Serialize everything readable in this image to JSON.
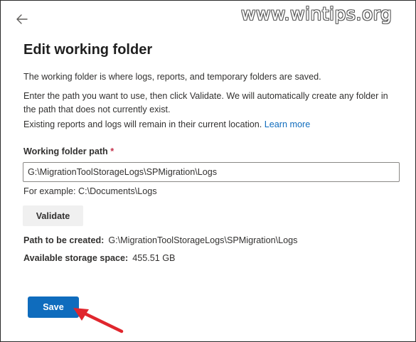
{
  "watermark": "www.wintips.org",
  "header": {
    "back_icon": "arrow-left-icon"
  },
  "page": {
    "title": "Edit working folder",
    "description_1": "The working folder is where logs, reports, and temporary folders are saved.",
    "description_2": "Enter the path you want to use, then click Validate. We will automatically create any folder in the path that does not currently exist.",
    "description_3": "Existing reports and logs will remain in their current location.",
    "learn_more": "Learn more"
  },
  "form": {
    "path_label": "Working folder path",
    "required_mark": "*",
    "path_value": "G:\\MigrationToolStorageLogs\\SPMigration\\Logs",
    "example": "For example: C:\\Documents\\Logs",
    "validate_label": "Validate",
    "path_to_create_label": "Path to be created:",
    "path_to_create_value": "G:\\MigrationToolStorageLogs\\SPMigration\\Logs",
    "storage_label": "Available storage space:",
    "storage_value": "455.51 GB",
    "save_label": "Save"
  },
  "colors": {
    "accent": "#0f6cbd",
    "required": "#c4314b",
    "annotation_arrow": "#e0262d"
  }
}
